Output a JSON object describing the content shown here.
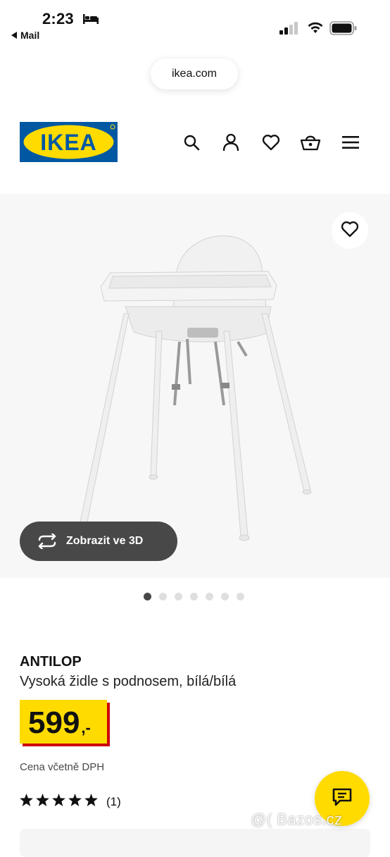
{
  "status_bar": {
    "time": "2:23",
    "back_label": "Mail"
  },
  "browser": {
    "url": "ikea.com"
  },
  "header": {
    "logo_text": "IKEA",
    "icons": [
      "search-icon",
      "profile-icon",
      "heart-icon",
      "basket-icon",
      "menu-icon"
    ]
  },
  "gallery": {
    "view_3d_label": "Zobrazit ve 3D",
    "dot_count": 7,
    "active_dot": 0
  },
  "product": {
    "name": "ANTILOP",
    "description": "Vysoká židle s podnosem, bílá/bílá",
    "price": "599",
    "price_suffix": ",-",
    "vat_note": "Cena včetně DPH",
    "rating_stars": 5,
    "rating_count": "(1)"
  },
  "watermark": "@( Bazos.cz",
  "colors": {
    "ikea_blue": "#0058a3",
    "ikea_yellow": "#ffdb00",
    "price_red": "#cc0008",
    "dark_button": "#484848"
  }
}
